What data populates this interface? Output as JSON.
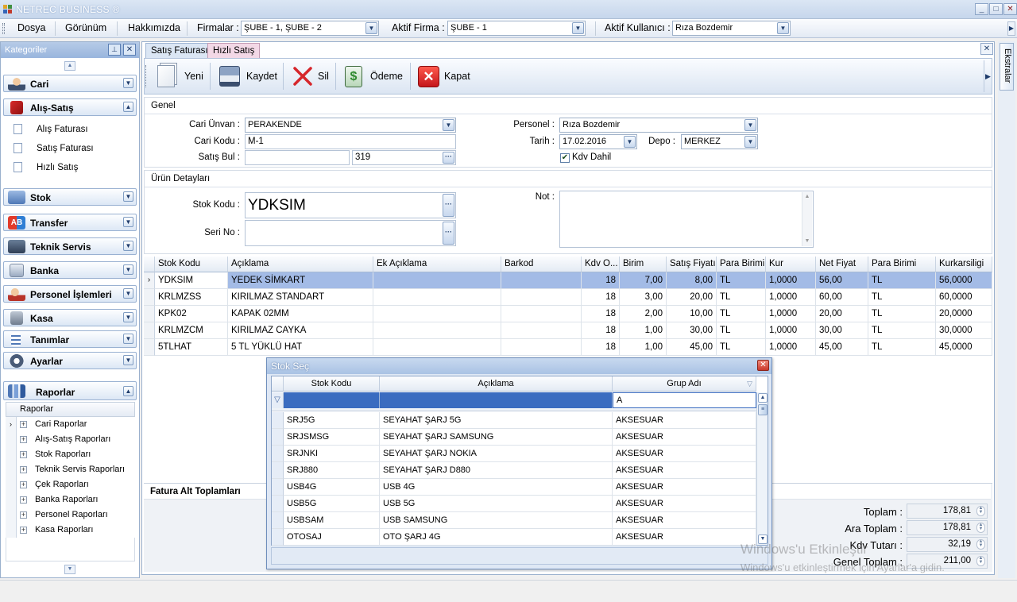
{
  "window": {
    "title": "NETREC BUSINESS ®",
    "minimize": "_",
    "maximize": "□",
    "close": "✕"
  },
  "menu": {
    "items": [
      "Dosya",
      "Görünüm",
      "Hakkımızda"
    ],
    "firmalar_label": "Firmalar :",
    "firmalar_value": "ŞUBE - 1, ŞUBE - 2",
    "aktif_firma_label": "Aktif Firma :",
    "aktif_firma_value": "ŞUBE - 1",
    "aktif_kullanici_label": "Aktif Kullanıcı :",
    "aktif_kullanici_value": "Rıza Bozdemir"
  },
  "sidebar": {
    "title": "Kategoriler",
    "groups": [
      "Cari",
      "Alış-Satış",
      "Stok",
      "Transfer",
      "Teknik Servis",
      "Banka",
      "Personel İşlemleri",
      "Kasa",
      "Tanımlar",
      "Ayarlar",
      "Raporlar"
    ],
    "alis_satis_items": [
      "Alış Faturası",
      "Satış Faturası",
      "Hızlı Satış"
    ],
    "raporlar_header": "Raporlar",
    "raporlar_items": [
      "Cari Raporlar",
      "Alış-Satış Raporları",
      "Stok Raporları",
      "Teknik Servis Raporları",
      "Çek Raporları",
      "Banka Raporları",
      "Personel Raporları",
      "Kasa Raporları"
    ]
  },
  "tabs": [
    "Satış Faturası",
    "Hızlı Satış"
  ],
  "toolbar": {
    "yeni": "Yeni",
    "kaydet": "Kaydet",
    "sil": "Sil",
    "odeme": "Ödeme",
    "kapat": "Kapat"
  },
  "genel": {
    "title": "Genel",
    "cari_unvan_label": "Cari Ünvan :",
    "cari_unvan": "PERAKENDE",
    "cari_kodu_label": "Cari Kodu :",
    "cari_kodu": "M-1",
    "satis_bul_label": "Satış Bul :",
    "satis_bul_value": "319",
    "personel_label": "Personel :",
    "personel": "Rıza Bozdemir",
    "tarih_label": "Tarih :",
    "tarih": "17.02.2016",
    "depo_label": "Depo :",
    "depo": "MERKEZ",
    "kdv_dahil": "Kdv Dahil"
  },
  "urun": {
    "title": "Ürün Detayları",
    "stok_kodu_label": "Stok Kodu :",
    "stok_kodu": "YDKSIM",
    "seri_no_label": "Seri No :",
    "not_label": "Not :"
  },
  "grid": {
    "columns": [
      "Stok Kodu",
      "Açıklama",
      "Ek Açıklama",
      "Barkod",
      "Kdv O...",
      "Birim",
      "Satış Fiyatı",
      "Para Birimi",
      "Kur",
      "Net Fiyat",
      "Para Birimi",
      "Kurkarsiligi"
    ],
    "rows": [
      [
        "YDKSIM",
        "YEDEK SİMKART",
        "",
        "",
        "18",
        "7,00",
        "8,00",
        "TL",
        "1,0000",
        "56,00",
        "TL",
        "56,0000"
      ],
      [
        "KRLMZSS",
        "KIRILMAZ STANDART",
        "",
        "",
        "18",
        "3,00",
        "20,00",
        "TL",
        "1,0000",
        "60,00",
        "TL",
        "60,0000"
      ],
      [
        "KPK02",
        "KAPAK 02MM",
        "",
        "",
        "18",
        "2,00",
        "10,00",
        "TL",
        "1,0000",
        "20,00",
        "TL",
        "20,0000"
      ],
      [
        "KRLMZCM",
        "KIRILMAZ CAYKA",
        "",
        "",
        "18",
        "1,00",
        "30,00",
        "TL",
        "1,0000",
        "30,00",
        "TL",
        "30,0000"
      ],
      [
        "5TLHAT",
        "5 TL YÜKLÜ HAT",
        "",
        "",
        "18",
        "1,00",
        "45,00",
        "TL",
        "1,0000",
        "45,00",
        "TL",
        "45,0000"
      ]
    ]
  },
  "totals": {
    "title": "Fatura Alt Toplamları",
    "toplam_label": "Toplam :",
    "toplam": "178,81",
    "ara_toplam_label": "Ara Toplam :",
    "ara_toplam": "178,81",
    "kdv_label": "Kdv Tutarı :",
    "kdv": "32,19",
    "genel_label": "Genel Toplam :",
    "genel": "211,00"
  },
  "dialog": {
    "title": "Stok Seç",
    "columns": [
      "Stok Kodu",
      "Açıklama",
      "Grup Adı"
    ],
    "filter_grup": "A",
    "rows": [
      [
        "SRJ5G",
        "SEYAHAT ŞARJ 5G",
        "AKSESUAR"
      ],
      [
        "SRJSMSG",
        "SEYAHAT ŞARJ SAMSUNG",
        "AKSESUAR"
      ],
      [
        "SRJNKI",
        "SEYAHAT ŞARJ NOKIA",
        "AKSESUAR"
      ],
      [
        "SRJ880",
        "SEYAHAT ŞARJ D880",
        "AKSESUAR"
      ],
      [
        "USB4G",
        "USB 4G",
        "AKSESUAR"
      ],
      [
        "USB5G",
        "USB 5G",
        "AKSESUAR"
      ],
      [
        "USBSAM",
        "USB SAMSUNG",
        "AKSESUAR"
      ],
      [
        "OTOSAJ",
        "OTO ŞARJ 4G",
        "AKSESUAR"
      ]
    ]
  },
  "right_strip": {
    "label": "Ekstralar"
  },
  "watermark": {
    "line1": "Windows'u Etkinleştir",
    "line2": "Windows'u etkinleştirmek için Ayarlar'a gidin."
  },
  "colors": {
    "selection": "#a3bbe6",
    "accent": "#c6d6ec",
    "delete_red": "#d6262b",
    "money_green": "#2f8a2f"
  },
  "checkbox": {
    "kdv_dahil_checked": true
  }
}
